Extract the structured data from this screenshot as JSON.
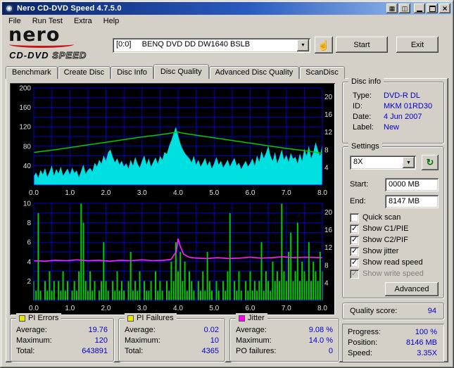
{
  "window": {
    "title": "Nero CD-DVD Speed 4.7.5.0"
  },
  "icons": {
    "close": "×",
    "dropdown": "▼",
    "refresh": "↻",
    "hand": "☝",
    "check": "✓",
    "extra_1": "▦",
    "extra_2": "◫"
  },
  "menu": [
    "File",
    "Run Test",
    "Extra",
    "Help"
  ],
  "logo": {
    "line1": "nero",
    "line2_a": "CD-DVD",
    "line2_b": "SPEED"
  },
  "toolbar": {
    "drive": "[0:0]     BENQ DVD DD DW1640 BSLB",
    "start": "Start",
    "exit": "Exit"
  },
  "tabs": {
    "items": [
      "Benchmark",
      "Create Disc",
      "Disc Info",
      "Disc Quality",
      "Advanced Disc Quality",
      "ScanDisc"
    ],
    "active": "Disc Quality"
  },
  "disc_info": {
    "title": "Disc info",
    "rows": [
      [
        "Type:",
        "DVD-R DL"
      ],
      [
        "ID:",
        "MKM 01RD30"
      ],
      [
        "Date:",
        "4 Jun 2007"
      ],
      [
        "Label:",
        "New"
      ]
    ]
  },
  "settings": {
    "title": "Settings",
    "speed": "8X",
    "start_label": "Start:",
    "start_value": "0000 MB",
    "end_label": "End:",
    "end_value": "8147 MB",
    "checkboxes": [
      {
        "label": "Quick scan",
        "checked": false,
        "disabled": false
      },
      {
        "label": "Show C1/PIE",
        "checked": true,
        "disabled": false
      },
      {
        "label": "Show C2/PIF",
        "checked": true,
        "disabled": false
      },
      {
        "label": "Show jitter",
        "checked": true,
        "disabled": false
      },
      {
        "label": "Show read speed",
        "checked": true,
        "disabled": false
      },
      {
        "label": "Show write speed",
        "checked": true,
        "disabled": true
      }
    ],
    "advanced": "Advanced"
  },
  "quality": {
    "label": "Quality score:",
    "value": "94"
  },
  "progress": {
    "rows": [
      [
        "Progress:",
        "100 %"
      ],
      [
        "Position:",
        "8146 MB"
      ],
      [
        "Speed:",
        "3.35X"
      ]
    ]
  },
  "stats": [
    {
      "title": "PI Errors",
      "color": "#e8e800",
      "rows": [
        [
          "Average:",
          "19.76"
        ],
        [
          "Maximum:",
          "120"
        ],
        [
          "Total:",
          "643891"
        ]
      ]
    },
    {
      "title": "PI Failures",
      "color": "#e8e800",
      "rows": [
        [
          "Average:",
          "0.02"
        ],
        [
          "Maximum:",
          "10"
        ],
        [
          "Total:",
          "4365"
        ]
      ]
    },
    {
      "title": "Jitter",
      "color": "#ff00ff",
      "rows": [
        [
          "Average:",
          "9.08 %"
        ],
        [
          "Maximum:",
          "14.0 %"
        ],
        [
          "PO failures:",
          "0"
        ]
      ]
    }
  ],
  "chart_data": [
    {
      "type": "area",
      "name": "pi-errors-and-read-speed",
      "x_range": [
        0,
        8
      ],
      "x_ticks": [
        "0.0",
        "1.0",
        "2.0",
        "3.0",
        "4.0",
        "5.0",
        "6.0",
        "7.0",
        "8.0"
      ],
      "left_axis": {
        "range": [
          0,
          200
        ],
        "ticks": [
          200,
          160,
          120,
          80,
          40
        ]
      },
      "right_axis": {
        "range": [
          0,
          22
        ],
        "ticks": [
          20,
          16,
          12,
          8,
          4
        ]
      },
      "grid": {
        "cols": 16,
        "rows": 10,
        "color": "#0000cc"
      },
      "tick_color": "#e0e0e0",
      "series": [
        {
          "name": "PI Errors",
          "type": "area",
          "axis": "left",
          "color": "#00e0e0",
          "values": [
            18,
            26,
            15,
            31,
            22,
            35,
            17,
            28,
            40,
            20,
            33,
            24,
            38,
            19,
            27,
            34,
            21,
            36,
            25,
            30,
            16,
            29,
            42,
            23,
            31,
            35,
            28,
            46,
            38,
            52,
            44,
            61,
            50,
            68,
            73,
            58,
            47,
            55,
            42,
            50,
            38,
            45,
            34,
            52,
            40,
            58,
            44,
            36,
            50,
            61,
            42,
            55,
            38,
            48,
            57,
            44,
            60,
            52,
            68,
            64,
            80,
            92,
            106,
            120,
            102,
            86,
            74,
            66,
            60,
            55,
            47,
            60,
            42,
            52,
            38,
            46,
            56,
            40,
            50,
            34,
            45,
            58,
            42,
            50,
            36,
            44,
            52,
            38,
            48,
            56,
            40,
            46,
            33,
            42,
            50,
            38,
            45,
            55,
            40,
            61,
            48,
            70,
            55,
            66,
            81,
            60,
            50,
            68,
            45,
            58,
            73,
            52,
            62,
            48,
            66,
            54,
            58,
            45,
            65,
            50,
            75,
            60,
            81,
            55,
            68,
            88,
            72,
            60,
            85
          ]
        },
        {
          "name": "Read speed",
          "type": "line",
          "axis": "right",
          "color": "#00cc00",
          "width": 1.5,
          "points": [
            [
              0,
              7.4
            ],
            [
              0.5,
              7.9
            ],
            [
              1.0,
              8.5
            ],
            [
              1.5,
              9.1
            ],
            [
              2.0,
              9.7
            ],
            [
              2.5,
              10.3
            ],
            [
              3.0,
              10.9
            ],
            [
              3.5,
              11.4
            ],
            [
              3.9,
              11.9
            ],
            [
              4.0,
              12.0
            ],
            [
              4.1,
              11.8
            ],
            [
              4.5,
              11.3
            ],
            [
              5.0,
              10.7
            ],
            [
              5.5,
              10.1
            ],
            [
              6.0,
              9.5
            ],
            [
              6.5,
              8.9
            ],
            [
              7.0,
              8.3
            ],
            [
              7.5,
              7.8
            ],
            [
              8.0,
              7.2
            ]
          ]
        }
      ]
    },
    {
      "type": "bar",
      "name": "pi-failures-and-jitter",
      "x_range": [
        0,
        8
      ],
      "x_ticks": [
        "0.0",
        "1.0",
        "2.0",
        "3.0",
        "4.0",
        "5.0",
        "6.0",
        "7.0",
        "8.0"
      ],
      "left_axis": {
        "range": [
          0,
          10
        ],
        "ticks": [
          10,
          8,
          6,
          4,
          2
        ]
      },
      "right_axis": {
        "range": [
          0,
          22
        ],
        "ticks": [
          20,
          16,
          12,
          8,
          4
        ]
      },
      "grid": {
        "cols": 16,
        "rows": 10,
        "color": "#0000cc"
      },
      "tick_color": "#e0e0e0",
      "series": [
        {
          "name": "PI Failures",
          "type": "bars",
          "axis": "left",
          "color": "#00cc00",
          "values": [
            2,
            1,
            9,
            1,
            0,
            2,
            1,
            3,
            1,
            2,
            0,
            2,
            1,
            3,
            1,
            2,
            0,
            1,
            2,
            1,
            3,
            10,
            8,
            2,
            1,
            3,
            1,
            2,
            0,
            1,
            2,
            6,
            2,
            1,
            0,
            2,
            1,
            3,
            1,
            2,
            1,
            0,
            2,
            5,
            1,
            2,
            1,
            3,
            0,
            2,
            1,
            1,
            2,
            0,
            3,
            1,
            2,
            1,
            0,
            2,
            1,
            4,
            2,
            6,
            3,
            5,
            2,
            4,
            1,
            3,
            2,
            1,
            0,
            2,
            1,
            3,
            1,
            5,
            2,
            1,
            0,
            2,
            1,
            0,
            2,
            1,
            3,
            9,
            0,
            2,
            1,
            3,
            1,
            0,
            2,
            1,
            3,
            1,
            2,
            1,
            2,
            6,
            1,
            3,
            2,
            1,
            4,
            2,
            3,
            2,
            10,
            3,
            2,
            5,
            7,
            2,
            3,
            8,
            2,
            4,
            3,
            2,
            6,
            2,
            4,
            3,
            2,
            5,
            3
          ]
        },
        {
          "name": "Jitter",
          "type": "line",
          "axis": "right",
          "color": "#ff22ff",
          "width": 1.6,
          "points": [
            [
              0,
              9.0
            ],
            [
              0.3,
              8.9
            ],
            [
              0.6,
              9.1
            ],
            [
              0.9,
              9.0
            ],
            [
              1.2,
              9.2
            ],
            [
              1.5,
              9.0
            ],
            [
              1.8,
              9.1
            ],
            [
              2.1,
              8.9
            ],
            [
              2.4,
              9.1
            ],
            [
              2.7,
              9.0
            ],
            [
              3.0,
              9.2
            ],
            [
              3.3,
              9.0
            ],
            [
              3.6,
              9.1
            ],
            [
              3.8,
              9.3
            ],
            [
              3.95,
              11.0
            ],
            [
              4.0,
              14.0
            ],
            [
              4.05,
              12.5
            ],
            [
              4.15,
              10.5
            ],
            [
              4.3,
              9.8
            ],
            [
              4.5,
              9.6
            ],
            [
              4.8,
              9.5
            ],
            [
              5.1,
              9.7
            ],
            [
              5.4,
              9.5
            ],
            [
              5.7,
              9.6
            ],
            [
              6.0,
              9.8
            ],
            [
              6.3,
              9.6
            ],
            [
              6.6,
              9.7
            ],
            [
              6.9,
              9.9
            ],
            [
              7.2,
              9.7
            ],
            [
              7.5,
              9.8
            ],
            [
              8.0,
              9.7
            ]
          ]
        }
      ]
    }
  ]
}
